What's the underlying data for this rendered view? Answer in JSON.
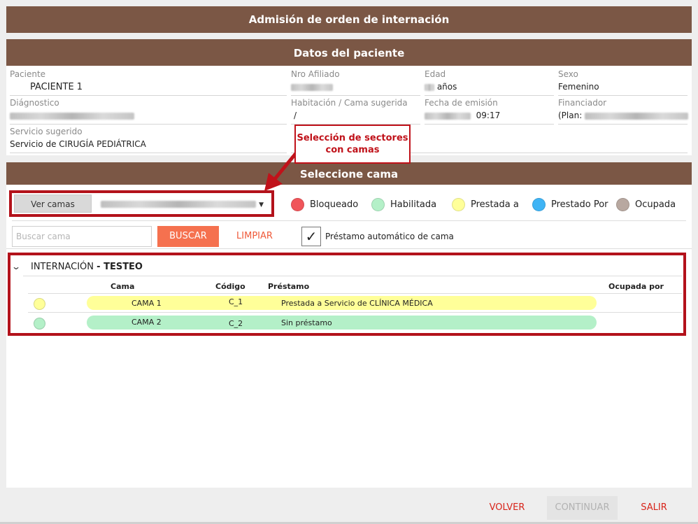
{
  "header": {
    "title": "Admisión de orden de internación"
  },
  "patient": {
    "section_title": "Datos del paciente",
    "paciente": {
      "label": "Paciente",
      "value": "PACIENTE 1"
    },
    "nro_afiliado": {
      "label": "Nro Afiliado"
    },
    "edad": {
      "label": "Edad",
      "unit": "años"
    },
    "sexo": {
      "label": "Sexo",
      "value": "Femenino"
    },
    "diagnostico": {
      "label": "Diágnostico"
    },
    "habitacion": {
      "label": "Habitación / Cama sugerida",
      "value": "/"
    },
    "fecha_emision": {
      "label": "Fecha de emisión",
      "time": "09:17"
    },
    "financiador": {
      "label": "Financiador",
      "plan_prefix": "(Plan:"
    },
    "servicio": {
      "label": "Servicio sugerido",
      "value": "Servicio de CIRUGÍA PEDIÁTRICA"
    }
  },
  "annotation": {
    "callout": "Selección de sectores con camas",
    "color": "#c0121a"
  },
  "bed_selection": {
    "section_title": "Seleccione cama",
    "ver_camas_label": "Ver camas",
    "legend": [
      {
        "label": "Bloqueado",
        "color": "#f0555a"
      },
      {
        "label": "Habilitada",
        "color": "#b4f0c8"
      },
      {
        "label": "Prestada a",
        "color": "#ffff99"
      },
      {
        "label": "Prestado Por",
        "color": "#3fb4f5"
      },
      {
        "label": "Ocupada",
        "color": "#b8a8a0"
      }
    ],
    "search_placeholder": "Buscar cama",
    "buscar_label": "BUSCAR",
    "limpiar_label": "LIMPIAR",
    "auto_loan_label": "Préstamo automático de cama",
    "auto_loan_checked": true,
    "group": {
      "name": "INTERNACIÓN",
      "subtitle": "- TESTEO"
    },
    "columns": [
      "Cama",
      "Código",
      "Préstamo",
      "Ocupada por"
    ],
    "rows": [
      {
        "cama": "CAMA 1",
        "codigo": "C_1",
        "prestamo": "Prestada a Servicio de CLÍNICA MÉDICA",
        "ocupada_por": "",
        "color": "#ffff99"
      },
      {
        "cama": "CAMA 2",
        "codigo": "C_2",
        "prestamo": "Sin préstamo",
        "ocupada_por": "",
        "color": "#b4f0c8"
      }
    ]
  },
  "footer": {
    "volver_label": "VOLVER",
    "continuar_label": "CONTINUAR",
    "salir_label": "SALIR"
  }
}
